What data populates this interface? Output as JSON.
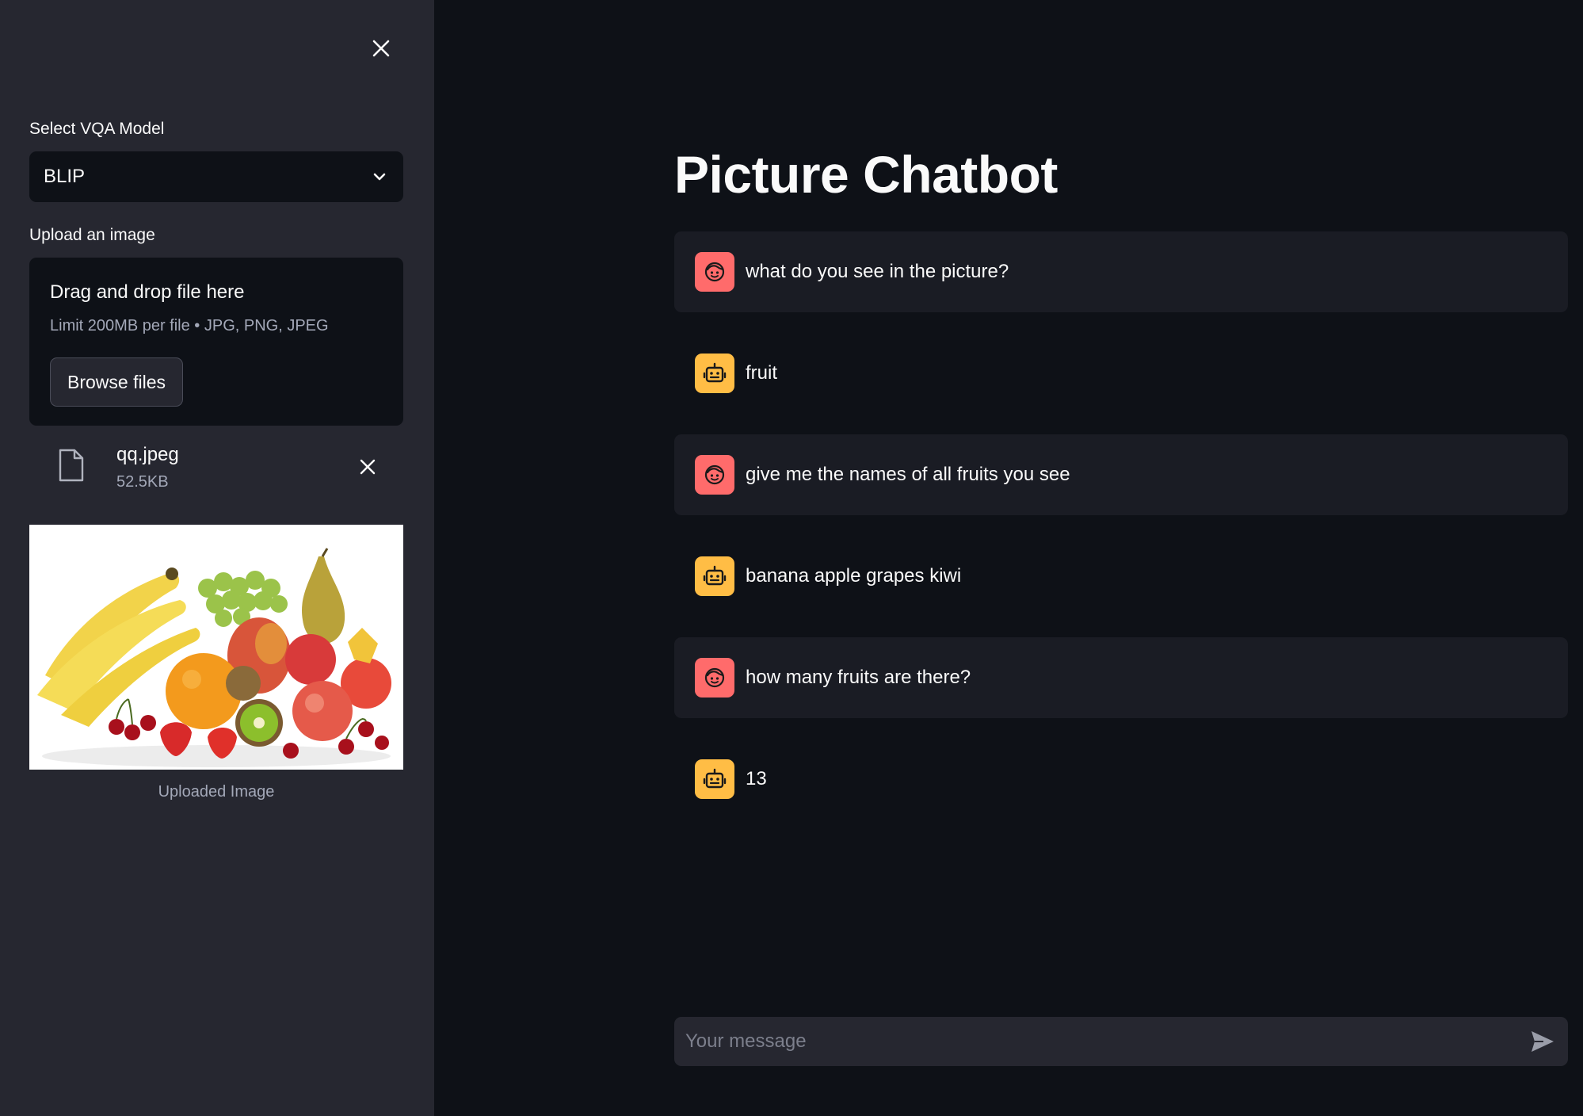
{
  "sidebar": {
    "close_icon": "close-icon",
    "model_label": "Select VQA Model",
    "model_selected": "BLIP",
    "upload_label": "Upload an image",
    "dropzone": {
      "title": "Drag and drop file here",
      "limit": "Limit 200MB per file • JPG, PNG, JPEG",
      "browse_label": "Browse files"
    },
    "file": {
      "name": "qq.jpeg",
      "size": "52.5KB"
    },
    "image_caption": "Uploaded Image"
  },
  "main": {
    "title": "Picture Chatbot",
    "messages": [
      {
        "role": "user",
        "text": "what do you see in the picture?"
      },
      {
        "role": "assistant",
        "text": "fruit"
      },
      {
        "role": "user",
        "text": "give me the names of all fruits you see"
      },
      {
        "role": "assistant",
        "text": "banana apple grapes kiwi"
      },
      {
        "role": "user",
        "text": "how many fruits are there?"
      },
      {
        "role": "assistant",
        "text": "13"
      }
    ],
    "input_placeholder": "Your message"
  },
  "colors": {
    "background": "#0e1117",
    "sidebar": "#262730",
    "user_avatar": "#ff6b6b",
    "assistant_avatar": "#ffbd45"
  }
}
